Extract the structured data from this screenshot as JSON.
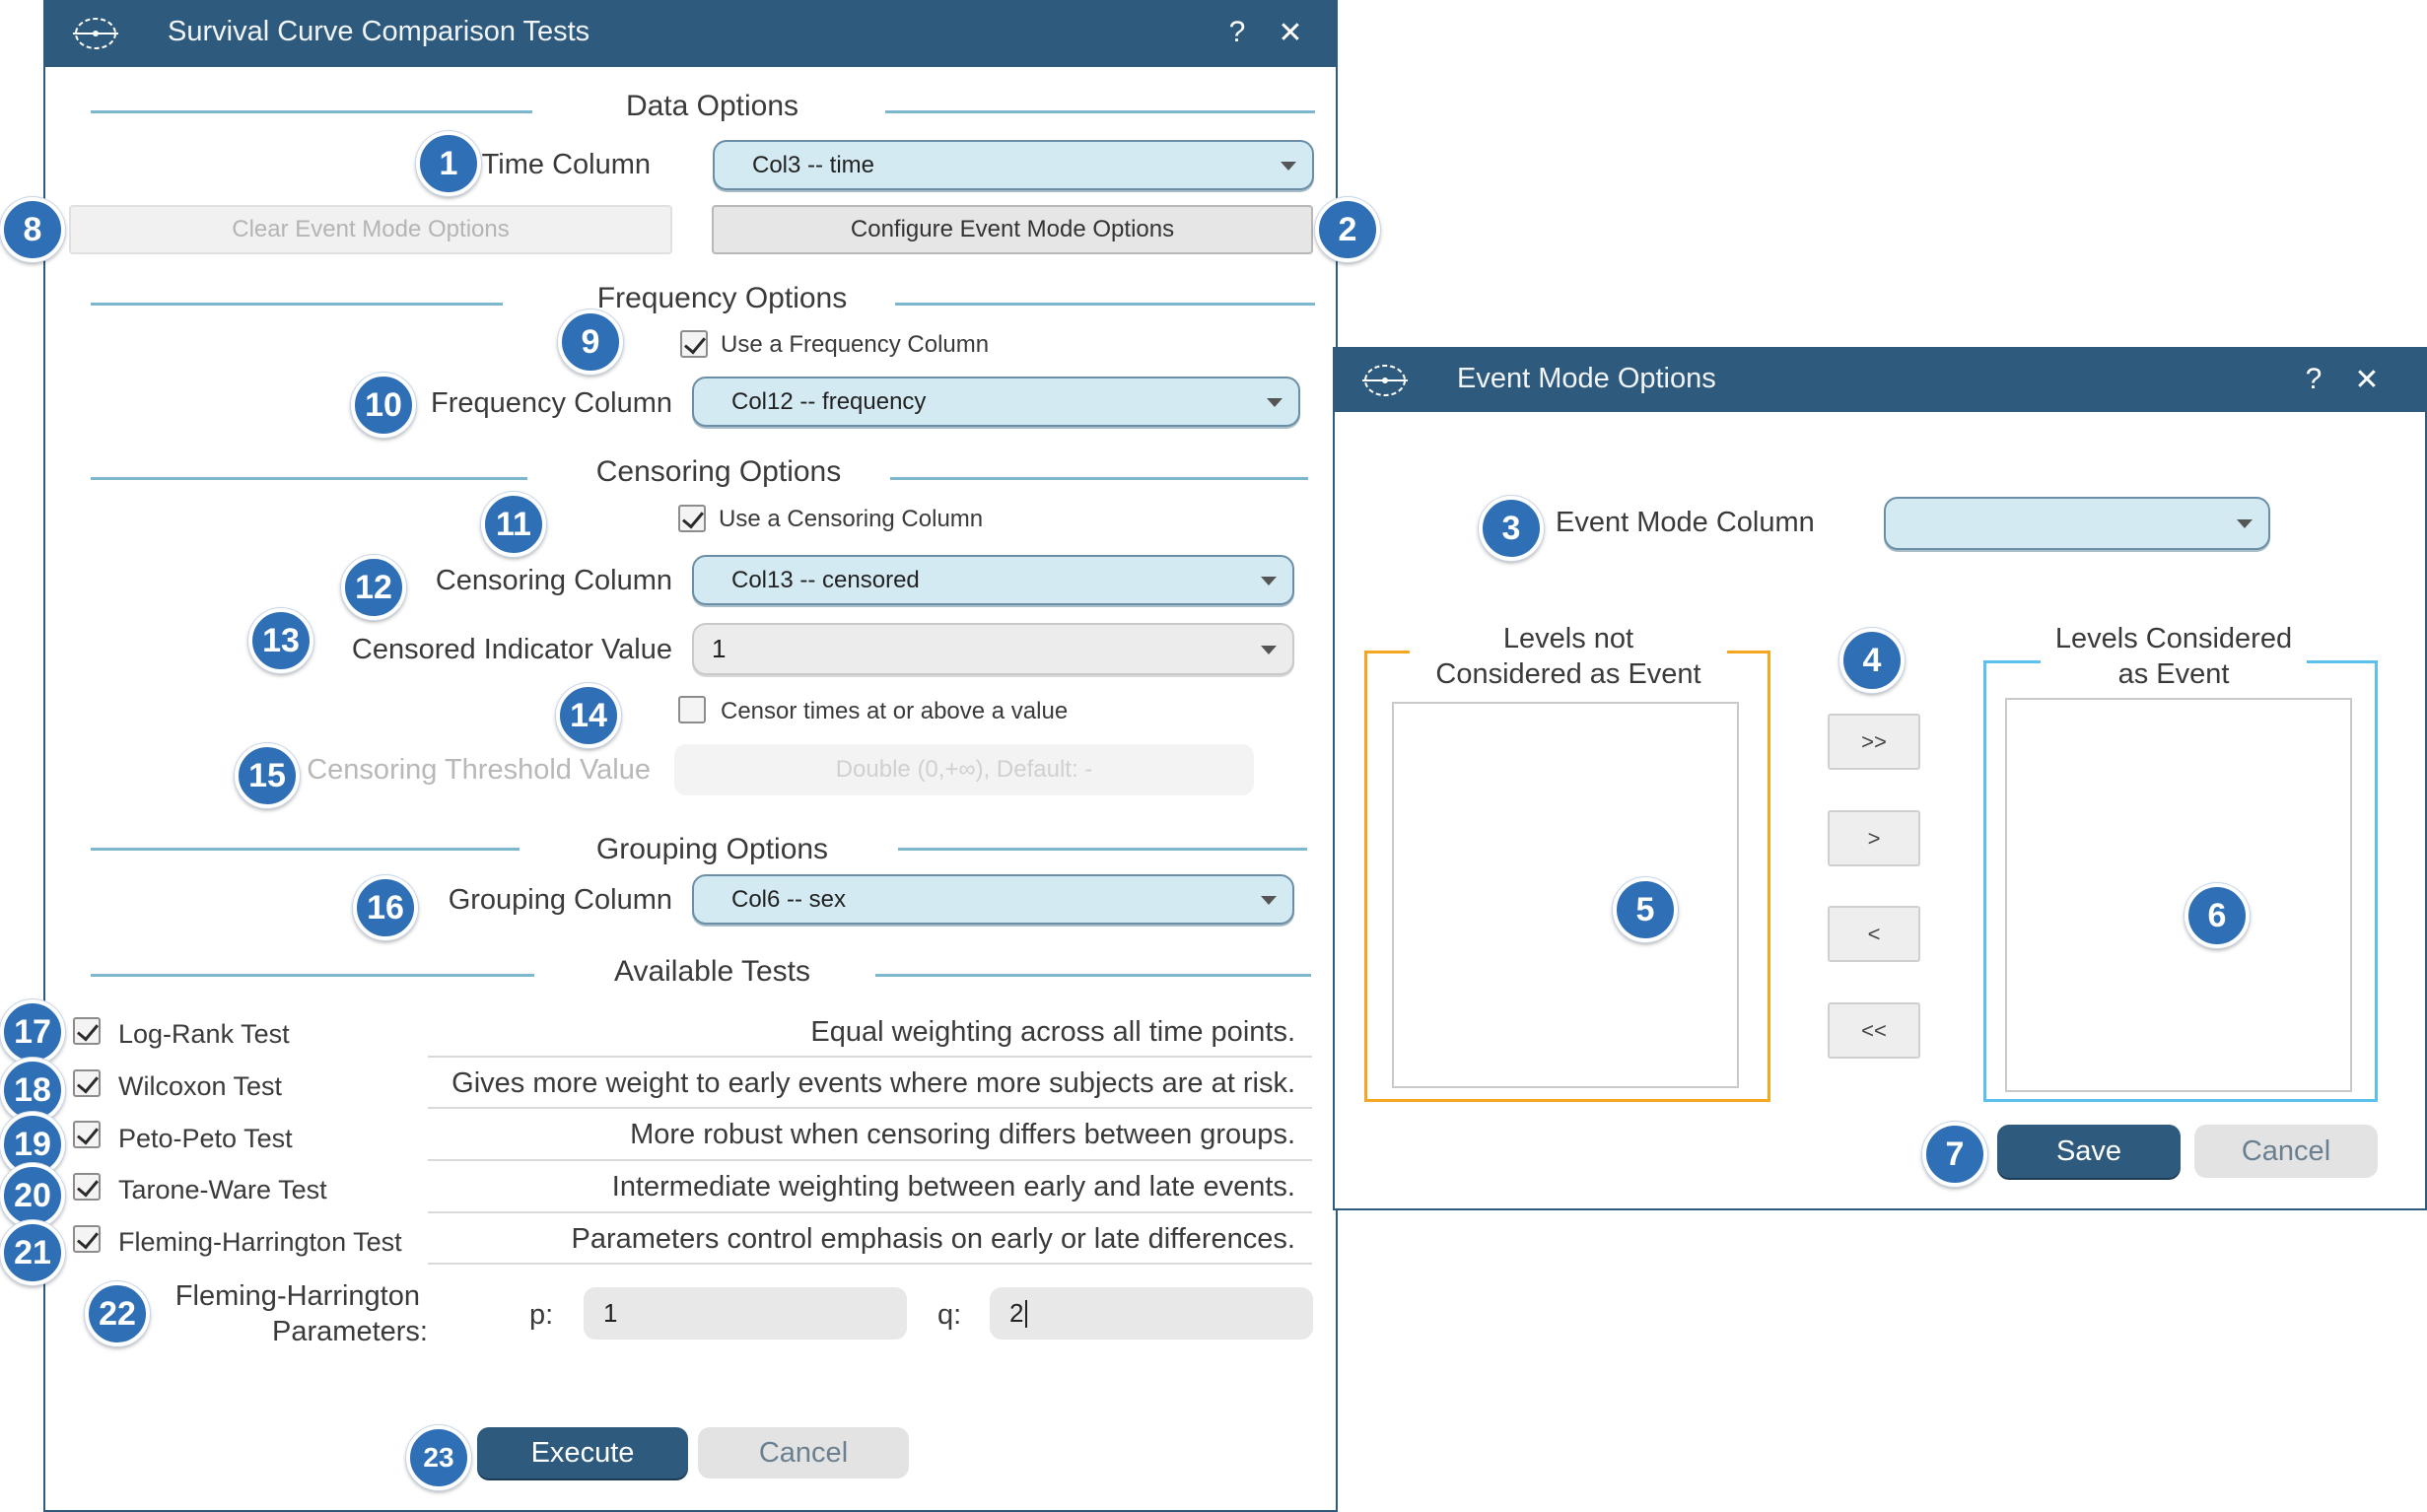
{
  "main_window": {
    "title": "Survival Curve Comparison Tests",
    "help_label": "?",
    "close_label": "✕",
    "sections": {
      "data": "Data Options",
      "frequency": "Frequency Options",
      "censoring": "Censoring Options",
      "grouping": "Grouping Options",
      "tests": "Available Tests"
    },
    "time_column": {
      "label": "Time Column",
      "value": "Col3 -- time"
    },
    "clear_event_mode_button": "Clear Event Mode Options",
    "configure_event_mode_button": "Configure Event Mode Options",
    "use_frequency_column": {
      "label": "Use a Frequency Column",
      "checked": true
    },
    "frequency_column": {
      "label": "Frequency Column",
      "value": "Col12 -- frequency"
    },
    "use_censoring_column": {
      "label": "Use a Censoring Column",
      "checked": true
    },
    "censoring_column": {
      "label": "Censoring Column",
      "value": "Col13 -- censored"
    },
    "censored_indicator": {
      "label": "Censored Indicator Value",
      "value": "1"
    },
    "censor_threshold_checkbox": {
      "label": "Censor times at or above a value",
      "checked": false
    },
    "censoring_threshold": {
      "label": "Censoring Threshold Value",
      "placeholder": "Double (0,+∞), Default: -"
    },
    "grouping_column": {
      "label": "Grouping Column",
      "value": "Col6 -- sex"
    },
    "tests": [
      {
        "name": "Log-Rank Test",
        "description": "Equal weighting across all time points.",
        "checked": true
      },
      {
        "name": "Wilcoxon Test",
        "description": "Gives more weight to early events where more subjects are at risk.",
        "checked": true
      },
      {
        "name": "Peto-Peto Test",
        "description": "More robust when censoring differs between groups.",
        "checked": true
      },
      {
        "name": "Tarone-Ware Test",
        "description": "Intermediate weighting between early and late events.",
        "checked": true
      },
      {
        "name": "Fleming-Harrington Test",
        "description": "Parameters control emphasis on early or late differences.",
        "checked": true
      }
    ],
    "fh_params": {
      "label_line1": "Fleming-Harrington",
      "label_line2": "Parameters:",
      "p_label": "p:",
      "p_value": "1",
      "q_label": "q:",
      "q_value": "2"
    },
    "execute_button": "Execute",
    "cancel_button": "Cancel"
  },
  "event_window": {
    "title": "Event Mode Options",
    "help_label": "?",
    "close_label": "✕",
    "event_mode_column": {
      "label": "Event Mode Column",
      "value": ""
    },
    "levels_not_event_title_1": "Levels not",
    "levels_not_event_title_2": "Considered as Event",
    "levels_event_title_1": "Levels Considered",
    "levels_event_title_2": "as Event",
    "move_all_right": ">>",
    "move_right": ">",
    "move_left": "<",
    "move_all_left": "<<",
    "save_button": "Save",
    "cancel_button": "Cancel"
  },
  "markers": [
    "1",
    "2",
    "3",
    "4",
    "5",
    "6",
    "7",
    "8",
    "9",
    "10",
    "11",
    "12",
    "13",
    "14",
    "15",
    "16",
    "17",
    "18",
    "19",
    "20",
    "21",
    "22",
    "23"
  ],
  "colors": {
    "titlebar": "#2e5a7e",
    "combo_fill": "#d3eaf2",
    "section_line": "#7db6cf",
    "marker": "#2f6fb5",
    "levels_not_border": "#f5a623",
    "levels_event_border": "#5bc0eb"
  }
}
